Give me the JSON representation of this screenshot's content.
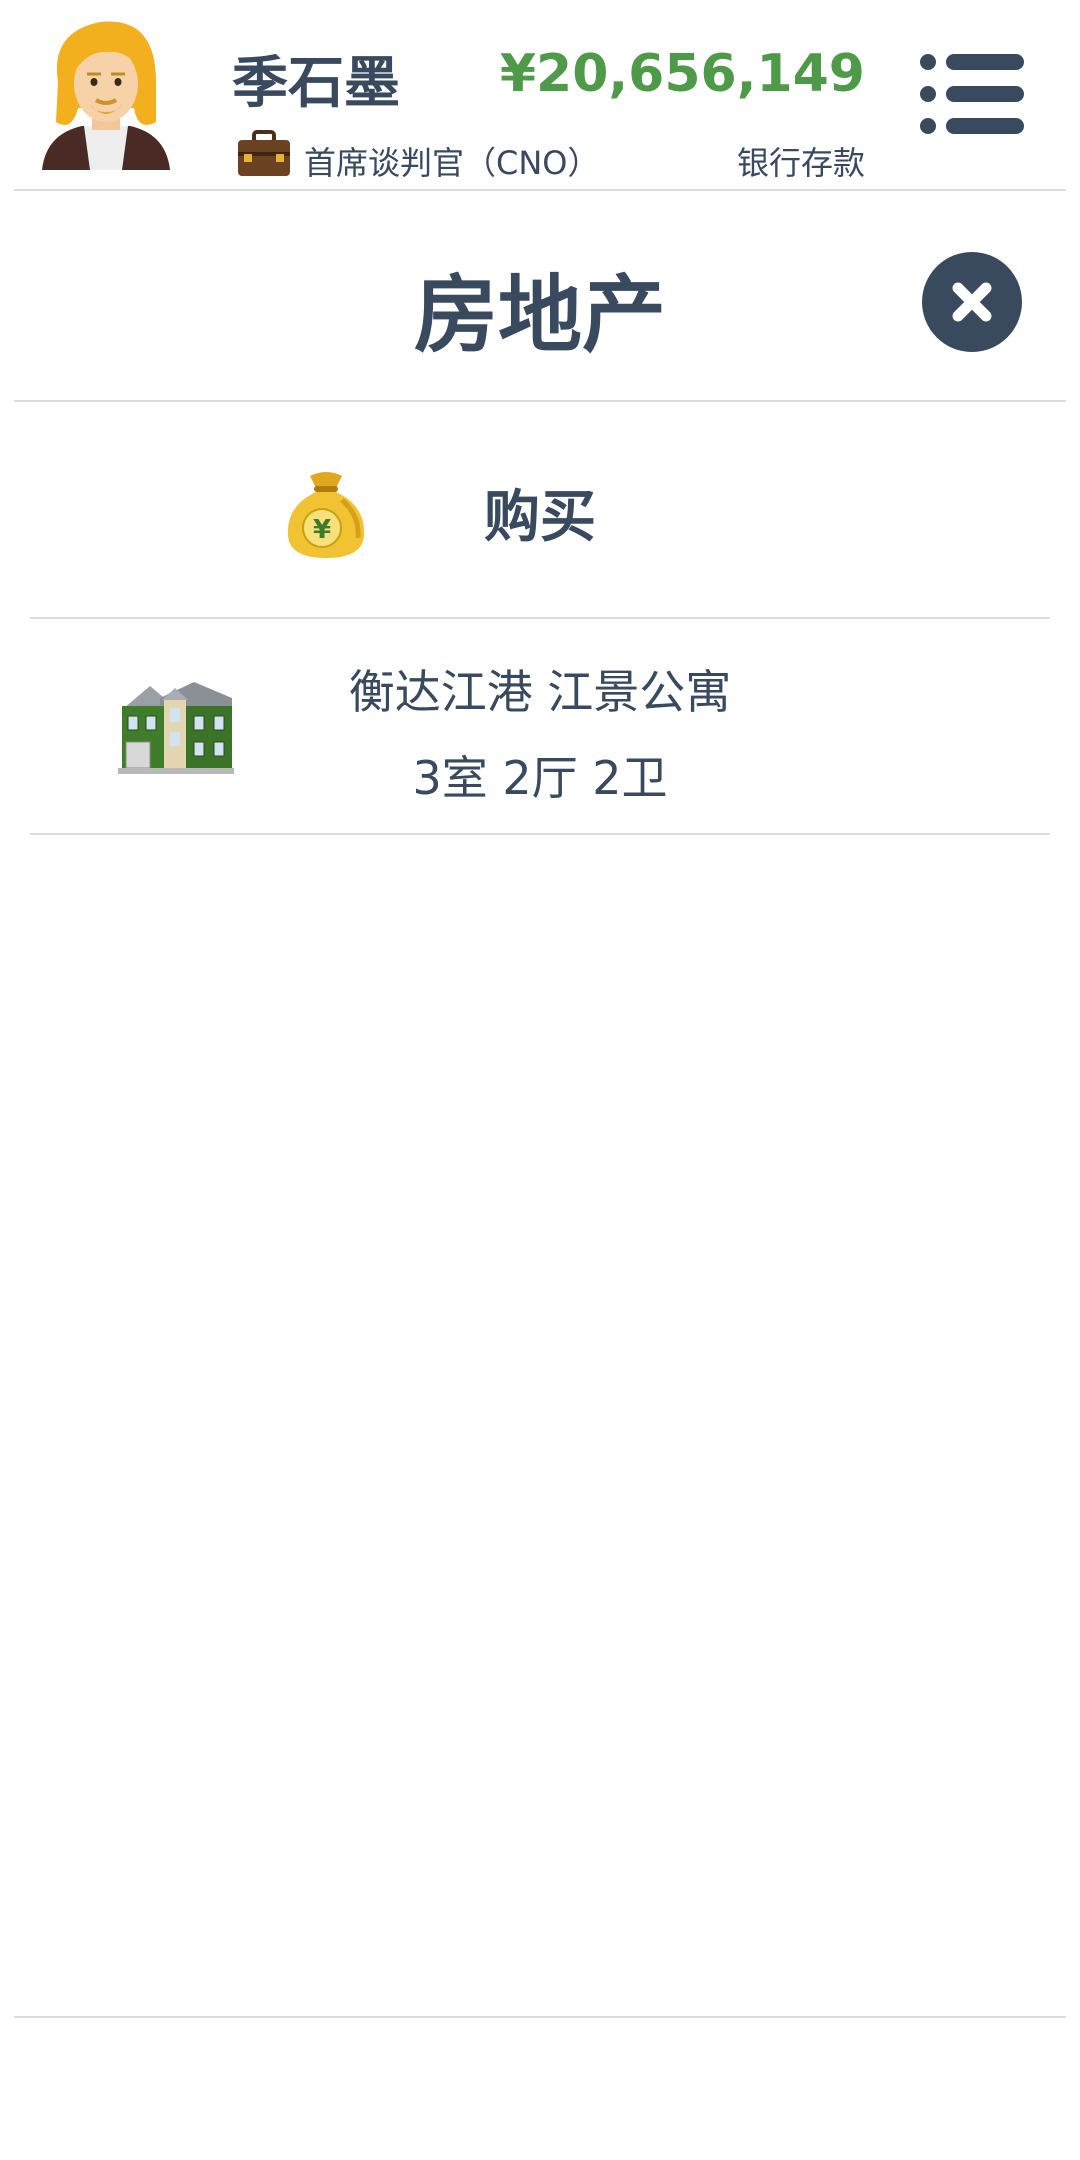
{
  "header": {
    "player_name": "季石墨",
    "job_title": "首席谈判官（CNO）",
    "balance": "¥20,656,149",
    "balance_label": "银行存款",
    "balance_color": "#4e9a48"
  },
  "section": {
    "title": "房地产"
  },
  "buy": {
    "label": "购买"
  },
  "properties": [
    {
      "name": "衡达江港 江景公寓",
      "rooms": "3室 2厅 2卫"
    }
  ],
  "icons": {
    "avatar": "avatar-icon",
    "briefcase": "briefcase-icon",
    "menu": "menu-list-icon",
    "close": "close-icon",
    "money_bag": "money-bag-icon",
    "house": "house-icon"
  },
  "colors": {
    "primary_text": "#3a4a5e",
    "accent_green": "#4e9a48",
    "divider": "#dcdcdc"
  }
}
